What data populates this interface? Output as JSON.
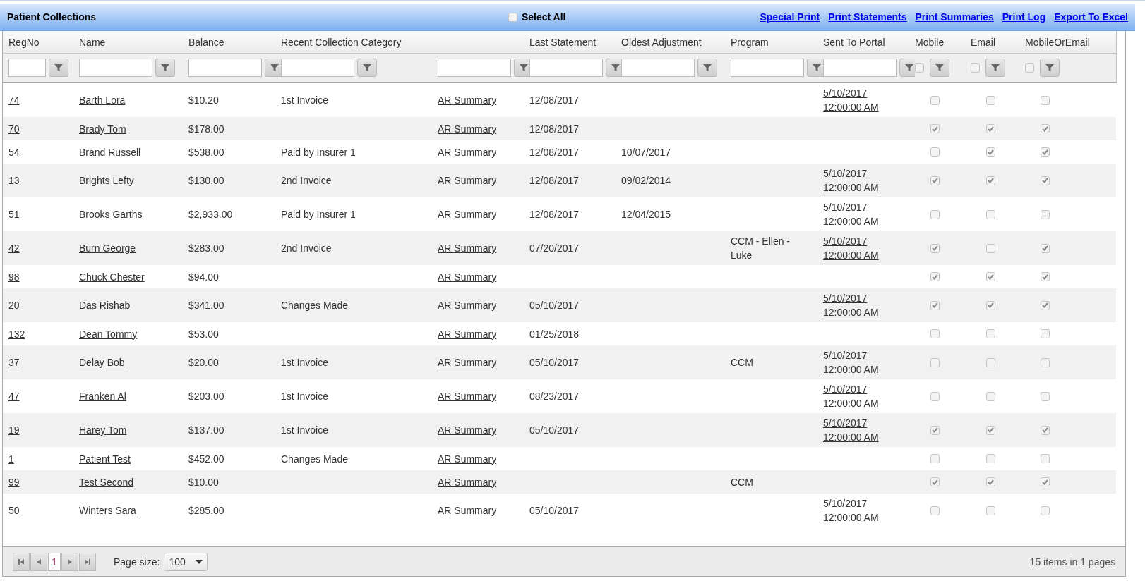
{
  "title": "Patient Collections",
  "select_all": {
    "label": "Select All",
    "checked": false
  },
  "actions": [
    "Special Print",
    "Print Statements",
    "Print Summaries",
    "Print Log",
    "Export To Excel"
  ],
  "columns": [
    {
      "label": "RegNo",
      "kind": "text"
    },
    {
      "label": "Name",
      "kind": "text"
    },
    {
      "label": "Balance",
      "kind": "text"
    },
    {
      "label": "Recent Collection Category",
      "kind": "text"
    },
    {
      "kind": "text"
    },
    {
      "label": "Last Statement",
      "kind": "text"
    },
    {
      "label": "Oldest Adjustment",
      "kind": "text"
    },
    {
      "label": "Program",
      "kind": "text"
    },
    {
      "label": "Sent To Portal",
      "kind": "text"
    },
    {
      "label": "Mobile",
      "kind": "check",
      "checked": false
    },
    {
      "label": "Email",
      "kind": "check",
      "checked": false
    },
    {
      "label": "MobileOrEmail",
      "kind": "check",
      "checked": false
    }
  ],
  "rows": [
    {
      "regno": "74",
      "name": "Barth Lora",
      "balance": "$10.20",
      "category": "1st Invoice",
      "summary": "AR Summary",
      "last_statement": "12/08/2017",
      "sent_to_portal": "5/10/2017 12:00:00 AM",
      "mobile": false,
      "email": false,
      "mobile_or_email": false
    },
    {
      "regno": "70",
      "name": "Brady Tom",
      "balance": "$178.00",
      "summary": "AR Summary",
      "last_statement": "12/08/2017",
      "mobile": true,
      "email": true,
      "mobile_or_email": true
    },
    {
      "regno": "54",
      "name": "Brand Russell",
      "balance": "$538.00",
      "category": "Paid by Insurer 1",
      "summary": "AR Summary",
      "last_statement": "12/08/2017",
      "oldest_adjustment": "10/07/2017",
      "mobile": false,
      "email": true,
      "mobile_or_email": true
    },
    {
      "regno": "13",
      "name": "Brights Lefty",
      "balance": "$130.00",
      "category": "2nd Invoice",
      "summary": "AR Summary",
      "last_statement": "12/08/2017",
      "oldest_adjustment": "09/02/2014",
      "sent_to_portal": "5/10/2017 12:00:00 AM",
      "mobile": true,
      "email": true,
      "mobile_or_email": true
    },
    {
      "regno": "51",
      "name": "Brooks Garths",
      "balance": "$2,933.00",
      "category": "Paid by Insurer 1",
      "summary": "AR Summary",
      "last_statement": "12/08/2017",
      "oldest_adjustment": "12/04/2015",
      "sent_to_portal": "5/10/2017 12:00:00 AM",
      "mobile": false,
      "email": false,
      "mobile_or_email": false
    },
    {
      "regno": "42",
      "name": "Burn George",
      "balance": "$283.00",
      "category": "2nd Invoice",
      "summary": "AR Summary",
      "last_statement": "07/20/2017",
      "program": "CCM - Ellen - Luke",
      "sent_to_portal": "5/10/2017 12:00:00 AM",
      "mobile": true,
      "email": false,
      "mobile_or_email": true
    },
    {
      "regno": "98",
      "name": "Chuck Chester",
      "balance": "$94.00",
      "summary": "AR Summary",
      "mobile": true,
      "email": true,
      "mobile_or_email": true
    },
    {
      "regno": "20",
      "name": "Das Rishab",
      "balance": "$341.00",
      "category": "Changes Made",
      "summary": "AR Summary",
      "last_statement": "05/10/2017",
      "sent_to_portal": "5/10/2017 12:00:00 AM",
      "mobile": true,
      "email": true,
      "mobile_or_email": true
    },
    {
      "regno": "132",
      "name": "Dean Tommy",
      "balance": "$53.00",
      "summary": "AR Summary",
      "last_statement": "01/25/2018",
      "mobile": false,
      "email": false,
      "mobile_or_email": false
    },
    {
      "regno": "37",
      "name": "Delay Bob",
      "balance": "$20.00",
      "category": "1st Invoice",
      "summary": "AR Summary",
      "last_statement": "05/10/2017",
      "program": "CCM",
      "sent_to_portal": "5/10/2017 12:00:00 AM",
      "mobile": false,
      "email": false,
      "mobile_or_email": false
    },
    {
      "regno": "47",
      "name": "Franken Al",
      "balance": "$203.00",
      "category": "1st Invoice",
      "summary": "AR Summary",
      "last_statement": "08/23/2017",
      "sent_to_portal": "5/10/2017 12:00:00 AM",
      "mobile": false,
      "email": false,
      "mobile_or_email": false
    },
    {
      "regno": "19",
      "name": "Harey Tom",
      "balance": "$137.00",
      "category": "1st Invoice",
      "summary": "AR Summary",
      "last_statement": "05/10/2017",
      "sent_to_portal": "5/10/2017 12:00:00 AM",
      "mobile": true,
      "email": true,
      "mobile_or_email": true
    },
    {
      "regno": "1",
      "name": "Patient Test",
      "balance": "$452.00",
      "category": "Changes Made",
      "summary": "AR Summary",
      "mobile": false,
      "email": false,
      "mobile_or_email": false
    },
    {
      "regno": "99",
      "name": "Test Second",
      "balance": "$10.00",
      "summary": "AR Summary",
      "program": "CCM",
      "mobile": true,
      "email": true,
      "mobile_or_email": true
    },
    {
      "regno": "50",
      "name": "Winters Sara",
      "balance": "$285.00",
      "summary": "AR Summary",
      "last_statement": "05/10/2017",
      "sent_to_portal": "5/10/2017 12:00:00 AM",
      "mobile": false,
      "email": false,
      "mobile_or_email": false
    }
  ],
  "pager": {
    "page": "1",
    "page_size_label": "Page size:",
    "page_size": "100",
    "summary": "15 items in 1 pages"
  }
}
